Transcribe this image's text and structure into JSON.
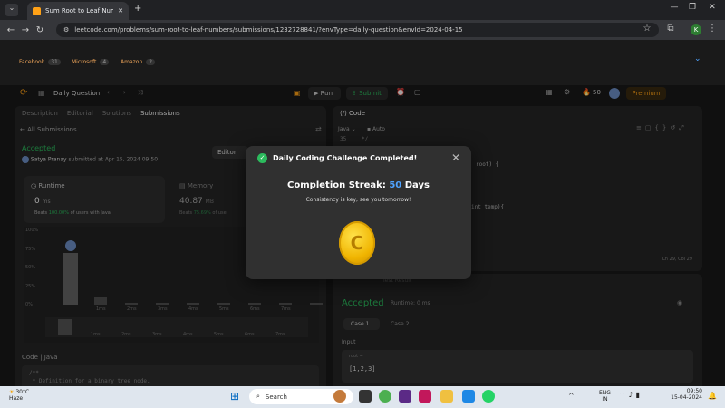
{
  "browser": {
    "tab_title": "Sum Root to Leaf Numbers - Le",
    "url": "leetcode.com/problems/sum-root-to-leaf-numbers/submissions/1232728841/?envType=daily-question&envId=2024-04-15",
    "profile_initial": "K"
  },
  "companies": [
    {
      "name": "Facebook",
      "count": "31"
    },
    {
      "name": "Microsoft",
      "count": "4"
    },
    {
      "name": "Amazon",
      "count": "2"
    }
  ],
  "header": {
    "daily_label": "Daily Question",
    "run_label": "Run",
    "submit_label": "Submit",
    "fire_count": "50",
    "premium_label": "Premium"
  },
  "left_tabs": [
    "Description",
    "Editorial",
    "Solutions",
    "Submissions"
  ],
  "submission": {
    "back_label": "All Submissions",
    "status": "Accepted",
    "user": "Satya Pranay",
    "submitted_text": "submitted at Apr 15, 2024 09:50",
    "editorial_btn": "Editor",
    "runtime_label": "Runtime",
    "runtime_value": "0",
    "runtime_unit": "ms",
    "runtime_beats": "Beats",
    "runtime_pct": "100.00%",
    "runtime_suffix": "of users with Java",
    "memory_label": "Memory",
    "memory_value": "40.87",
    "memory_unit": "MB",
    "memory_beats": "Beats",
    "memory_pct": "75.69%",
    "memory_suffix": "of use",
    "code_label": "Code",
    "code_lang": "Java",
    "code_snippet": "/**",
    "code_line2": " * Definition for a binary tree node."
  },
  "chart_data": {
    "type": "bar",
    "ylabels": [
      "100%",
      "75%",
      "50%",
      "25%",
      "0%"
    ],
    "xlabels": [
      "1ms",
      "2ms",
      "3ms",
      "4ms",
      "5ms",
      "6ms",
      "7ms"
    ],
    "xlabels2": [
      "1ms",
      "2ms",
      "3ms",
      "4ms",
      "5ms",
      "6ms",
      "7ms"
    ],
    "values": [
      70,
      10,
      3,
      3,
      3,
      3,
      3,
      3,
      3
    ],
    "ylim": [
      0,
      100
    ]
  },
  "right": {
    "code_tab": "Code",
    "lang": "Java",
    "auto_label": "Auto",
    "line_no": "35",
    "line_text": "*/",
    "code_frag1": "root) {",
    "code_frag2": "int temp){",
    "cursor_pos": "Ln 29, Col 29",
    "test_result_label": "Test Result",
    "accepted": "Accepted",
    "runtime_text": "Runtime: 0 ms",
    "case1": "Case 1",
    "case2": "Case 2",
    "input_label": "Input",
    "root_label": "root =",
    "root_value": "[1,2,3]"
  },
  "modal": {
    "title": "Daily Coding Challenge Completed!",
    "streak_label": "Completion Streak:",
    "streak_num": "50",
    "streak_unit": "Days",
    "subtitle": "Consistency is key, see you tomorrow!"
  },
  "taskbar": {
    "temp": "30°C",
    "weather": "Haze",
    "search_placeholder": "Search",
    "lang1": "ENG",
    "lang2": "IN",
    "time": "09:50",
    "date": "15-04-2024"
  }
}
